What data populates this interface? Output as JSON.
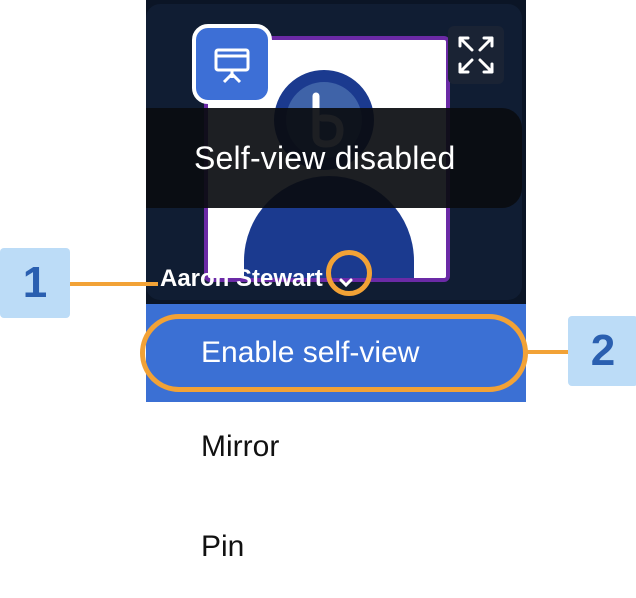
{
  "tile": {
    "participant_name": "Aaron Stewart",
    "overlay_message": "Self-view disabled",
    "present_icon": "presentation-icon",
    "expand_icon": "expand-icon",
    "dropdown_icon": "chevron-down-icon"
  },
  "menu": {
    "items": [
      {
        "label": "Enable self-view",
        "highlighted": true
      },
      {
        "label": "Mirror"
      },
      {
        "label": "Pin"
      }
    ]
  },
  "callouts": {
    "first": "1",
    "second": "2"
  },
  "colors": {
    "accent": "#3b70d4",
    "callout_bg": "#bcdcf7",
    "callout_text": "#2a5fb0",
    "highlight_ring": "#f2a236",
    "tile_bg": "#101d33"
  }
}
